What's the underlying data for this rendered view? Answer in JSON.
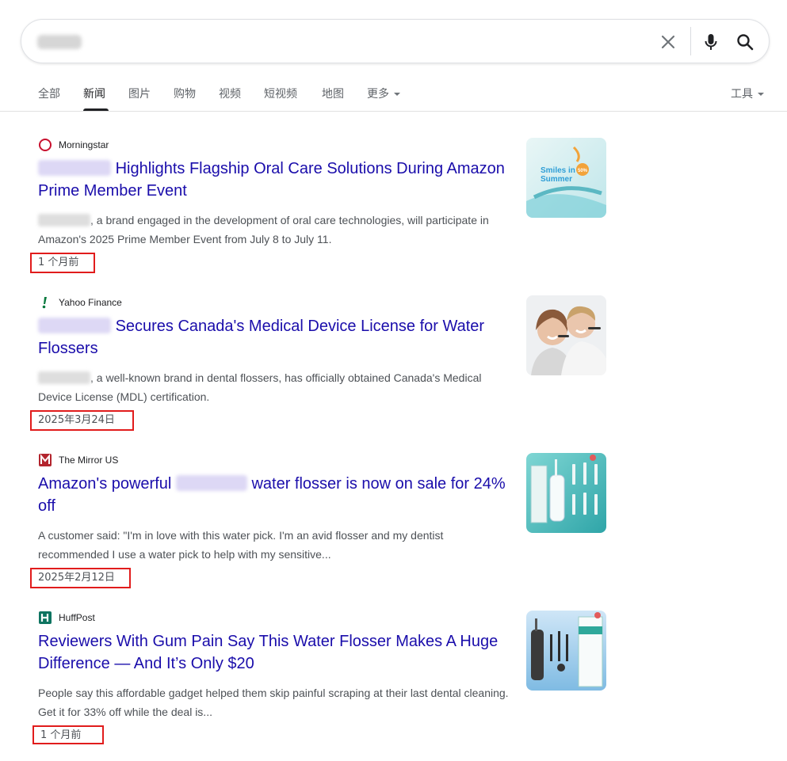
{
  "search": {
    "query": "",
    "placeholder": ""
  },
  "tabs": [
    {
      "label": "全部"
    },
    {
      "label": "新闻"
    },
    {
      "label": "图片"
    },
    {
      "label": "购物"
    },
    {
      "label": "视频"
    },
    {
      "label": "短视频"
    },
    {
      "label": "地图"
    },
    {
      "label": "更多"
    }
  ],
  "tools_label": "工具",
  "results": [
    {
      "source": "Morningstar",
      "title_rest": "Highlights Flagship Oral Care Solutions During Amazon Prime Member Event",
      "snippet_rest": ", a brand engaged in the development of oral care technologies, will participate in Amazon's 2025 Prime Member Event from July 8 to July 11.",
      "date": "1 个月前",
      "thumb_text_1": "Smiles in",
      "thumb_text_2": "Summer",
      "thumb_badge": "50%"
    },
    {
      "source": "Yahoo Finance",
      "title_rest": "Secures Canada's Medical Device License for Water Flossers",
      "snippet_rest": ", a well-known brand in dental flossers, has officially obtained Canada's Medical Device License (MDL) certification.",
      "date": "2025年3月24日"
    },
    {
      "source": "The Mirror US",
      "title_before": "Amazon's powerful",
      "title_after": "water flosser is now on sale for 24% off",
      "snippet": "A customer said: \"I'm in love with this water pick. I'm an avid flosser and my dentist recommended I use a water pick to help with my sensitive...",
      "date": "2025年2月12日"
    },
    {
      "source": "HuffPost",
      "title": "Reviewers With Gum Pain Say This Water Flosser Makes A Huge Difference — And It’s Only $20",
      "snippet": "People say this affordable gadget helped them skip painful scraping at their last dental cleaning. Get it for 33% off while the deal is...",
      "date": "1 个月前"
    }
  ],
  "colors": {
    "link": "#1a0dab",
    "highlight_box": "#e11c1c",
    "tab_active": "#202124"
  }
}
